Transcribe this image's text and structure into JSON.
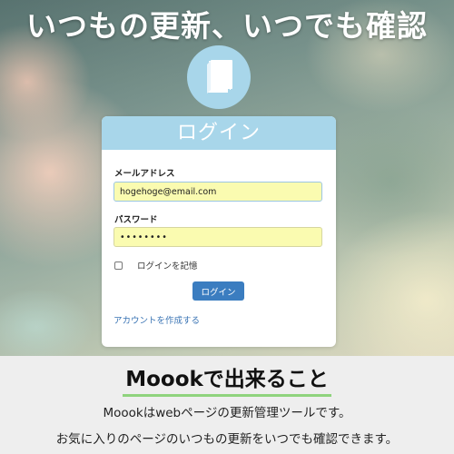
{
  "hero": {
    "headline": "いつもの更新、いつでも確認",
    "icon": "book-icon"
  },
  "login_card": {
    "title": "ログイン",
    "email_label": "メールアドレス",
    "email_value": "hogehoge@email.com",
    "password_label": "パスワード",
    "password_value": "••••••••",
    "remember_label": "ログインを記憶",
    "remember_checked": false,
    "login_button": "ログイン",
    "create_account_link": "アカウントを作成する"
  },
  "features": {
    "title": "Moookで出来ること",
    "line1": "Moookはwebページの更新管理ツールです。",
    "line2": "お気に入りのページのいつもの更新をいつでも確認できます。"
  },
  "colors": {
    "header_blue": "#a8d6ea",
    "button_blue": "#3b7dc0",
    "input_yellow": "#fafbb0",
    "underline_green": "#8fd37d"
  }
}
